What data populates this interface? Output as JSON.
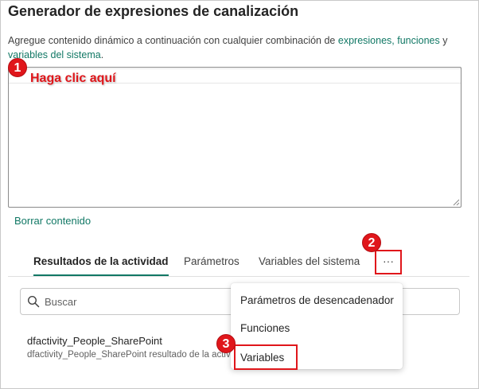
{
  "title": "Generador de expresiones de canalización",
  "description": {
    "prefix": "Agregue contenido dinámico a continuación con cualquier combinación de",
    "link_expressions": "expresiones",
    "comma": ",",
    "link_functions": "funciones",
    "and": "y",
    "link_variables": "variables del sistema",
    "period": "."
  },
  "callout": "Haga clic aquí",
  "badges": [
    "1",
    "2",
    "3"
  ],
  "clear_link": "Borrar contenido",
  "tabs": [
    {
      "label": "Resultados de la actividad",
      "active": true
    },
    {
      "label": "Parámetros",
      "active": false
    },
    {
      "label": "Variables del sistema",
      "active": false
    }
  ],
  "more_button": "···",
  "search": {
    "placeholder": "Buscar",
    "icon": "search-icon"
  },
  "result": {
    "name": "dfactivity_People_SharePoint",
    "subtitle": "dfactivity_People_SharePoint resultado de la actividad"
  },
  "menu": {
    "items": [
      "Parámetros de desencadenador",
      "Funciones",
      "Variables"
    ]
  },
  "colors": {
    "accent": "#117865",
    "annotation": "#e0161b"
  }
}
